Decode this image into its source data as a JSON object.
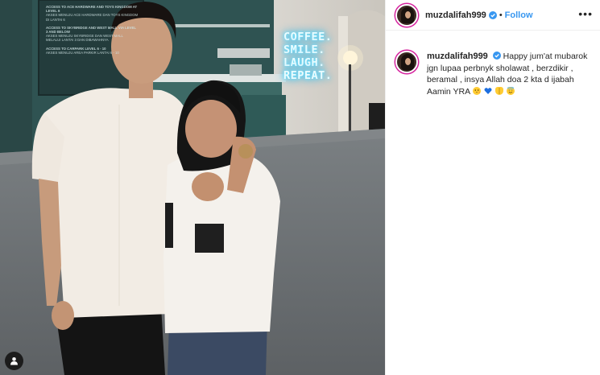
{
  "post": {
    "photo_alt": "",
    "neon_sign": [
      "COFFEE.",
      "SMILE.",
      "LAUGH.",
      "REPEAT."
    ],
    "board_lines": [
      {
        "title": "ACCESS TO ACE HARDWARE AND TOYS KINGDOM AT LEVEL 6",
        "text": "AKSES MENUJU ACE HARDWARE DAN TOYS KINGDOM DI LANTAI 6"
      },
      {
        "title": "ACCESS TO SKYBRIDGE AND WEST MALL VIA LEVEL 3 AND BELOW",
        "text": "AKSES MENUJU SKYBRIDGE DAN WEST MALL MELALUI LANTAI 3 DAN DIBAWAHNYA"
      },
      {
        "title": "ACCESS TO CARPARK LEVEL 6 - 10",
        "text": "AKSES MENUJU AREA PARKIR LANTAI 6 - 10"
      }
    ]
  },
  "header": {
    "username": "muzdalifah999",
    "separator": "•",
    "follow_label": "Follow",
    "more_label": "•••"
  },
  "caption": {
    "username": "muzdalifah999",
    "text": "Happy jum'at mubarok jgn lupaa perbnyk sholawat , berzdikir , beramal , insya Allah doa 2 kta d ijabah Aamin YRA",
    "emojis": [
      "kiss-face",
      "blue-heart",
      "folded-hands",
      "smiling-face-with-halo"
    ]
  },
  "colors": {
    "follow": "#3897f0",
    "verified": "#3897f0",
    "story_ring": "#d6249f",
    "text": "#262626",
    "border": "#efefef",
    "neon": "#29c6ff",
    "heart": "#1d6fe0"
  }
}
